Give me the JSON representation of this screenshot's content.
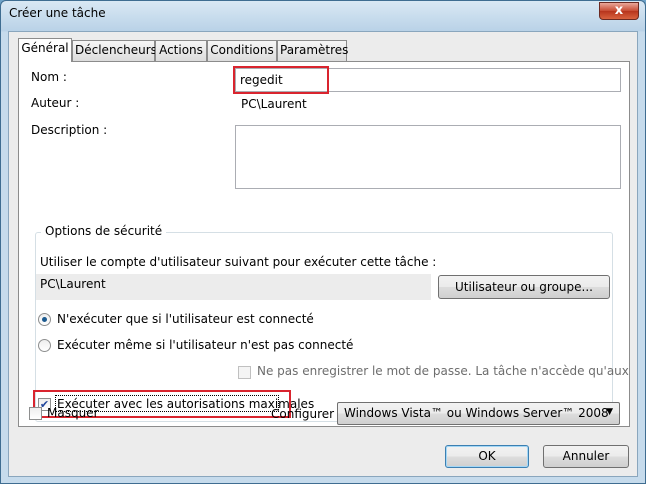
{
  "window": {
    "title": "Créer une tâche",
    "close": "x"
  },
  "tabs": [
    "Général",
    "Déclencheurs",
    "Actions",
    "Conditions",
    "Paramètres"
  ],
  "general": {
    "name_label": "Nom :",
    "name_value": "regedit",
    "author_label": "Auteur :",
    "author_value": "PC\\Laurent",
    "description_label": "Description :",
    "description_value": ""
  },
  "security": {
    "group_title": "Options de sécurité",
    "account_prompt": "Utiliser le compte d'utilisateur suivant pour exécuter cette tâche :",
    "account_value": "PC\\Laurent",
    "user_group_button": "Utilisateur ou groupe...",
    "radio_logged_on": "N'exécuter que si l'utilisateur est connecté",
    "radio_any": "Exécuter même si l'utilisateur n'est pas connecté",
    "no_store_password": "Ne pas enregistrer le mot de passe. La tâche n'accède qu'aux",
    "highest_privileges": "Exécuter avec les autorisations maximales"
  },
  "bottom": {
    "hide_label": "Masquer",
    "configure_label": "Configurer",
    "configure_value": "Windows Vista™ ou Windows Server™ 2008",
    "ok_button": "OK",
    "cancel_button": "Annuler"
  },
  "colors": {
    "highlight": "#d9242e",
    "accent": "#1c5a8f"
  }
}
